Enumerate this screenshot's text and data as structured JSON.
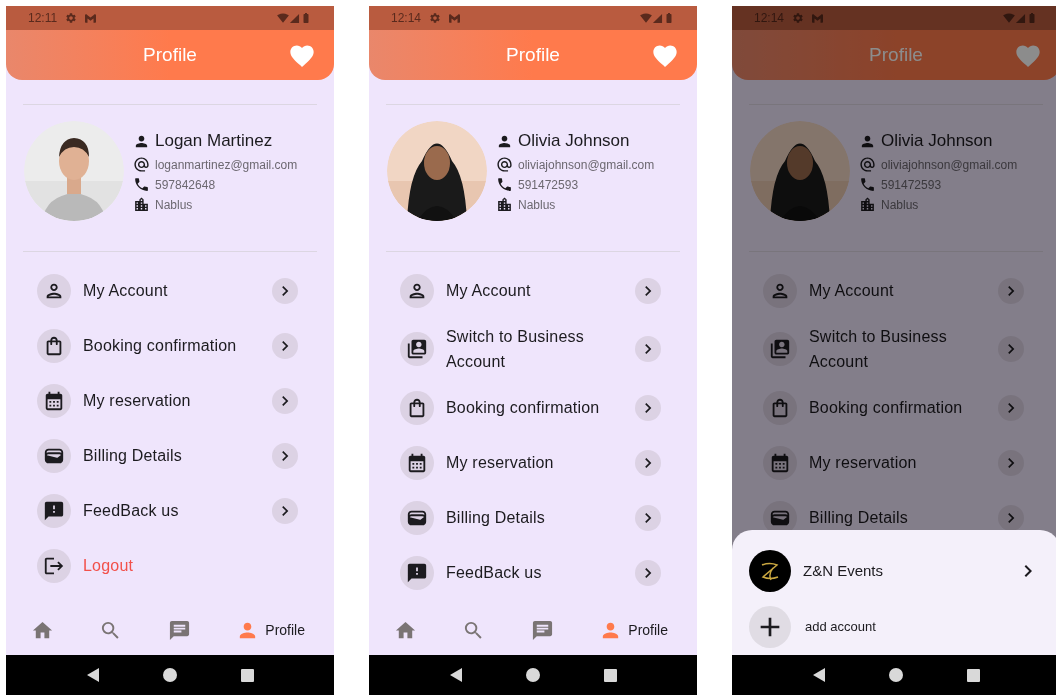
{
  "phones": [
    {
      "status_time": "12:11",
      "title": "Profile",
      "dimmed": false,
      "user": {
        "name": "Logan Martinez",
        "email": "loganmartinez@gmail.com",
        "phone": "597842648",
        "city": "Nablus"
      },
      "menu": [
        {
          "kind": "account",
          "label": "My Account"
        },
        {
          "kind": "booking",
          "label": "Booking confirmation"
        },
        {
          "kind": "reservation",
          "label": "My reservation"
        },
        {
          "kind": "billing",
          "label": "Billing Details"
        },
        {
          "kind": "feedback",
          "label": "FeedBack us"
        },
        {
          "kind": "logout",
          "label": "Logout"
        }
      ],
      "nav": [
        {
          "kind": "home",
          "selected": false
        },
        {
          "kind": "search",
          "selected": false
        },
        {
          "kind": "chat",
          "selected": false
        },
        {
          "kind": "profile",
          "selected": true,
          "label": "Profile"
        }
      ]
    },
    {
      "status_time": "12:14",
      "title": "Profile",
      "dimmed": false,
      "user": {
        "name": "Olivia Johnson",
        "email": "oliviajohnson@gmail.com",
        "phone": "591472593",
        "city": "Nablus"
      },
      "menu": [
        {
          "kind": "account",
          "label": "My Account"
        },
        {
          "kind": "business",
          "label": "Switch to Business Account"
        },
        {
          "kind": "booking",
          "label": "Booking confirmation"
        },
        {
          "kind": "reservation",
          "label": "My reservation"
        },
        {
          "kind": "billing",
          "label": "Billing Details"
        },
        {
          "kind": "feedback",
          "label": "FeedBack us"
        }
      ],
      "nav": [
        {
          "kind": "home",
          "selected": false
        },
        {
          "kind": "search",
          "selected": false
        },
        {
          "kind": "chat",
          "selected": false
        },
        {
          "kind": "profile",
          "selected": true,
          "label": "Profile"
        }
      ]
    },
    {
      "status_time": "12:14",
      "title": "Profile",
      "dimmed": true,
      "user": {
        "name": "Olivia Johnson",
        "email": "oliviajohnson@gmail.com",
        "phone": "591472593",
        "city": "Nablus"
      },
      "menu": [
        {
          "kind": "account",
          "label": "My Account"
        },
        {
          "kind": "business",
          "label": "Switch to Business Account"
        },
        {
          "kind": "booking",
          "label": "Booking confirmation"
        },
        {
          "kind": "reservation",
          "label": "My reservation"
        },
        {
          "kind": "billing",
          "label": "Billing Details"
        }
      ],
      "sheet": {
        "accounts": [
          {
            "kind": "business",
            "name": "Z&N Events"
          },
          {
            "kind": "add",
            "name": "add account"
          }
        ]
      }
    }
  ]
}
